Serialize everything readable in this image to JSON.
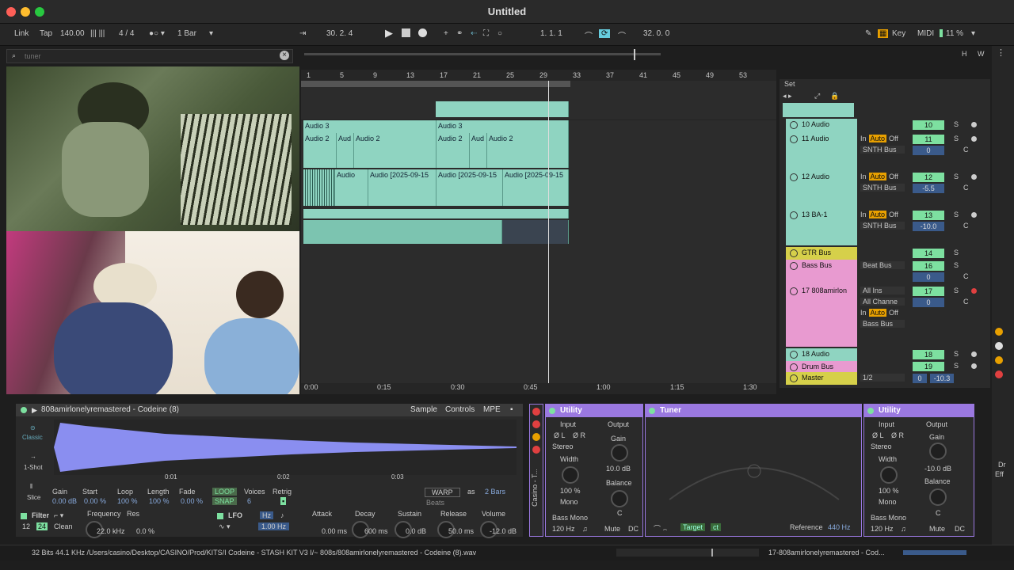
{
  "window": {
    "title": "Untitled"
  },
  "toolbar": {
    "link": "Link",
    "tap": "Tap",
    "tempo": "140.00",
    "sig": "4 / 4",
    "quant": "1 Bar",
    "position": "30.  2.  4",
    "loop_start": "1.  1.  1",
    "loop_len": "32.  0.  0",
    "key": "Key",
    "midi": "MIDI",
    "cpu": "11 %"
  },
  "browser": {
    "search_placeholder": "tuner"
  },
  "ruler": {
    "marks": [
      "1",
      "5",
      "9",
      "13",
      "17",
      "21",
      "25",
      "29",
      "33",
      "37",
      "41",
      "45",
      "49",
      "53"
    ],
    "set": "Set"
  },
  "clips": {
    "audio3a": "Audio 3",
    "audio3b": "Audio 3",
    "audio2a": "Audio 2",
    "aud": "Aud",
    "audio2b": "Audio 2",
    "audio2c": "Audio 2",
    "aud2": "Aud",
    "audio2d": "Audio 2",
    "audio": "Audio",
    "audio_d1": "Audio [2025-09-15",
    "audio_d2": "Audio [2025-09-15",
    "audio_d3": "Audio [2025-09-15"
  },
  "tracks": [
    {
      "name": "10 Audio",
      "num": "10",
      "color": "#8fd4c1"
    },
    {
      "name": "11 Audio",
      "num": "11",
      "color": "#8fd4c1",
      "vol": "0",
      "route": "SNTH Bus"
    },
    {
      "name": "12 Audio",
      "num": "12",
      "color": "#8fd4c1",
      "vol": "-5.5",
      "route": "SNTH Bus"
    },
    {
      "name": "13 BA-1",
      "num": "13",
      "color": "#8fd4c1",
      "vol": "-10.0",
      "route": "SNTH Bus"
    },
    {
      "name": "GTR Bus",
      "num": "14",
      "color": "#d6d04a"
    },
    {
      "name": "Bass Bus",
      "num": "16",
      "color": "#e89ad0",
      "vol": "0",
      "route": "Beat Bus"
    },
    {
      "name": "17 808amirlon",
      "num": "17",
      "color": "#e89ad0",
      "vol": "0",
      "route": "Bass Bus",
      "in": "All Ins",
      "ch": "All Channe"
    },
    {
      "name": "18 Audio",
      "num": "18",
      "color": "#8fd4c1"
    },
    {
      "name": "Drum Bus",
      "num": "19",
      "color": "#e89ad0"
    },
    {
      "name": "Master",
      "num": "0",
      "color": "#d6d04a",
      "vol": "-10.3",
      "route": "1/2"
    }
  ],
  "mixer_labels": {
    "in": "In",
    "auto": "Auto",
    "off": "Off",
    "s": "S",
    "c": "C"
  },
  "timeline": [
    "0:00",
    "0:15",
    "0:30",
    "0:45",
    "1:00",
    "1:15",
    "1:30"
  ],
  "simpler": {
    "title": "808amirlonelyremastered - Codeine (8)",
    "tabs": [
      "Sample",
      "Controls",
      "MPE"
    ],
    "modes": [
      "Classic",
      "1-Shot",
      "Slice"
    ],
    "marks": [
      "0:01",
      "0:02",
      "0:03"
    ],
    "params": {
      "gain": "Gain",
      "gain_v": "0.00 dB",
      "start": "Start",
      "start_v": "0.00 %",
      "loop": "Loop",
      "loop_v": "100 %",
      "length": "Length",
      "length_v": "100 %",
      "fade": "Fade",
      "fade_v": "0.00 %",
      "voices": "Voices",
      "voices_v": "6",
      "retrig": "Retrig",
      "loop_btn": "LOOP",
      "snap": "SNAP",
      "warp": "WARP",
      "as": "as",
      "bars": "2 Bars",
      "beats": "Beats"
    },
    "filter": {
      "label": "Filter",
      "freq": "Frequency",
      "freq_v": "22.0 kHz",
      "res": "Res",
      "res_v": "0.0 %",
      "n1": "12",
      "n2": "24",
      "clean": "Clean"
    },
    "lfo": {
      "label": "LFO",
      "hz": "Hz",
      "rate": "1.00 Hz"
    },
    "env": {
      "attack": "Attack",
      "attack_v": "0.00 ms",
      "decay": "Decay",
      "decay_v": "600 ms",
      "sustain": "Sustain",
      "sustain_v": "0.0 dB",
      "release": "Release",
      "release_v": "50.0 ms",
      "volume": "Volume",
      "volume_v": "-12.0 dB"
    }
  },
  "utility1": {
    "title": "Utility",
    "input": "Input",
    "output": "Output",
    "l": "Ø L",
    "r": "Ø R",
    "stereo": "Stereo",
    "gain": "Gain",
    "gain_v": "10.0 dB",
    "width": "Width",
    "width_v": "100 %",
    "mono": "Mono",
    "balance": "Balance",
    "bass_mono": "Bass Mono",
    "freq": "120 Hz",
    "mute": "Mute",
    "dc": "DC",
    "c": "C"
  },
  "tuner": {
    "title": "Tuner",
    "target": "Target",
    "ct": "ct",
    "reference": "Reference",
    "ref_v": "440 Hz"
  },
  "utility2": {
    "title": "Utility",
    "input": "Input",
    "output": "Output",
    "l": "Ø L",
    "r": "Ø R",
    "stereo": "Stereo",
    "gain": "Gain",
    "gain_v": "-10.0 dB",
    "width": "Width",
    "width_v": "100 %",
    "mono": "Mono",
    "balance": "Balance",
    "bass_mono": "Bass Mono",
    "freq": "120 Hz",
    "mute": "Mute",
    "dc": "DC",
    "c": "C"
  },
  "chain_label": "Casino - T...",
  "status": {
    "path": "32 Bits 44.1 KHz /Users/casino/Desktop/CASINO/Prod/KITS/I Codeine - STASH KIT V3 I/~ 808s/808amirlonelyremastered - Codeine (8).wav",
    "track": "17-808amirlonelyremastered - Cod..."
  },
  "side": {
    "h": "H",
    "w": "W",
    "dr": "Dr",
    "eff": "Eff"
  }
}
